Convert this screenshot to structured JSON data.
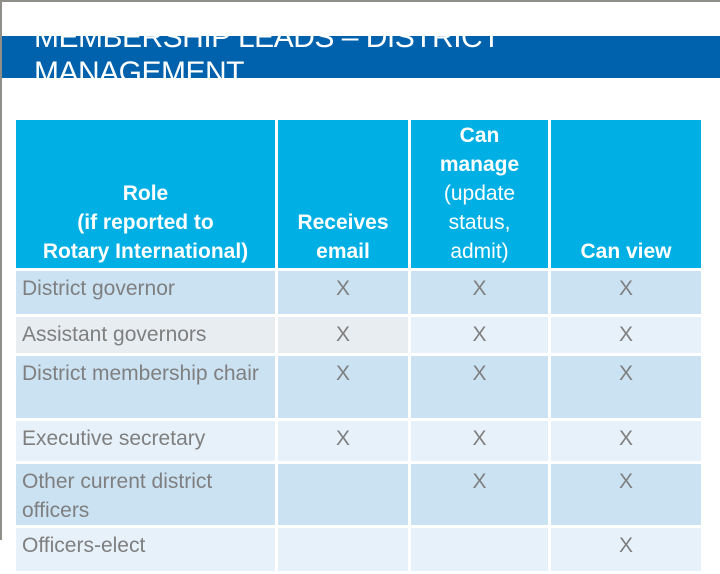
{
  "slide": {
    "title": "Membership Leads – District Management"
  },
  "colors": {
    "title_band": "#0062ac",
    "header": "#00b0e4",
    "row_dark": "#cbe2f3",
    "row_light": "#e7f1f9",
    "body_text": "#7f7f7f"
  },
  "table": {
    "headers": {
      "role": "Role\n(if reported to\nRotary International)",
      "role_line1": "Role",
      "role_line2": "(if reported to",
      "role_line3": "Rotary International)",
      "receives_email_line1": "Receives",
      "receives_email_line2": "email",
      "can_manage_line1": "Can",
      "can_manage_line2": "manage",
      "can_manage_line3": "(update",
      "can_manage_line4": "status,",
      "can_manage_line5": "admit)",
      "can_view": "Can view"
    },
    "rows": [
      {
        "role": "District governor",
        "receives_email": "X",
        "can_manage": "X",
        "can_view": "X"
      },
      {
        "role": "Assistant governors",
        "receives_email": "X",
        "can_manage": "X",
        "can_view": "X"
      },
      {
        "role": "District membership chair",
        "receives_email": "X",
        "can_manage": "X",
        "can_view": "X"
      },
      {
        "role": "Executive secretary",
        "receives_email": "X",
        "can_manage": "X",
        "can_view": "X"
      },
      {
        "role": "Other current district officers",
        "receives_email": "",
        "can_manage": "X",
        "can_view": "X"
      },
      {
        "role": "Officers-elect",
        "receives_email": "",
        "can_manage": "",
        "can_view": "X"
      }
    ]
  }
}
